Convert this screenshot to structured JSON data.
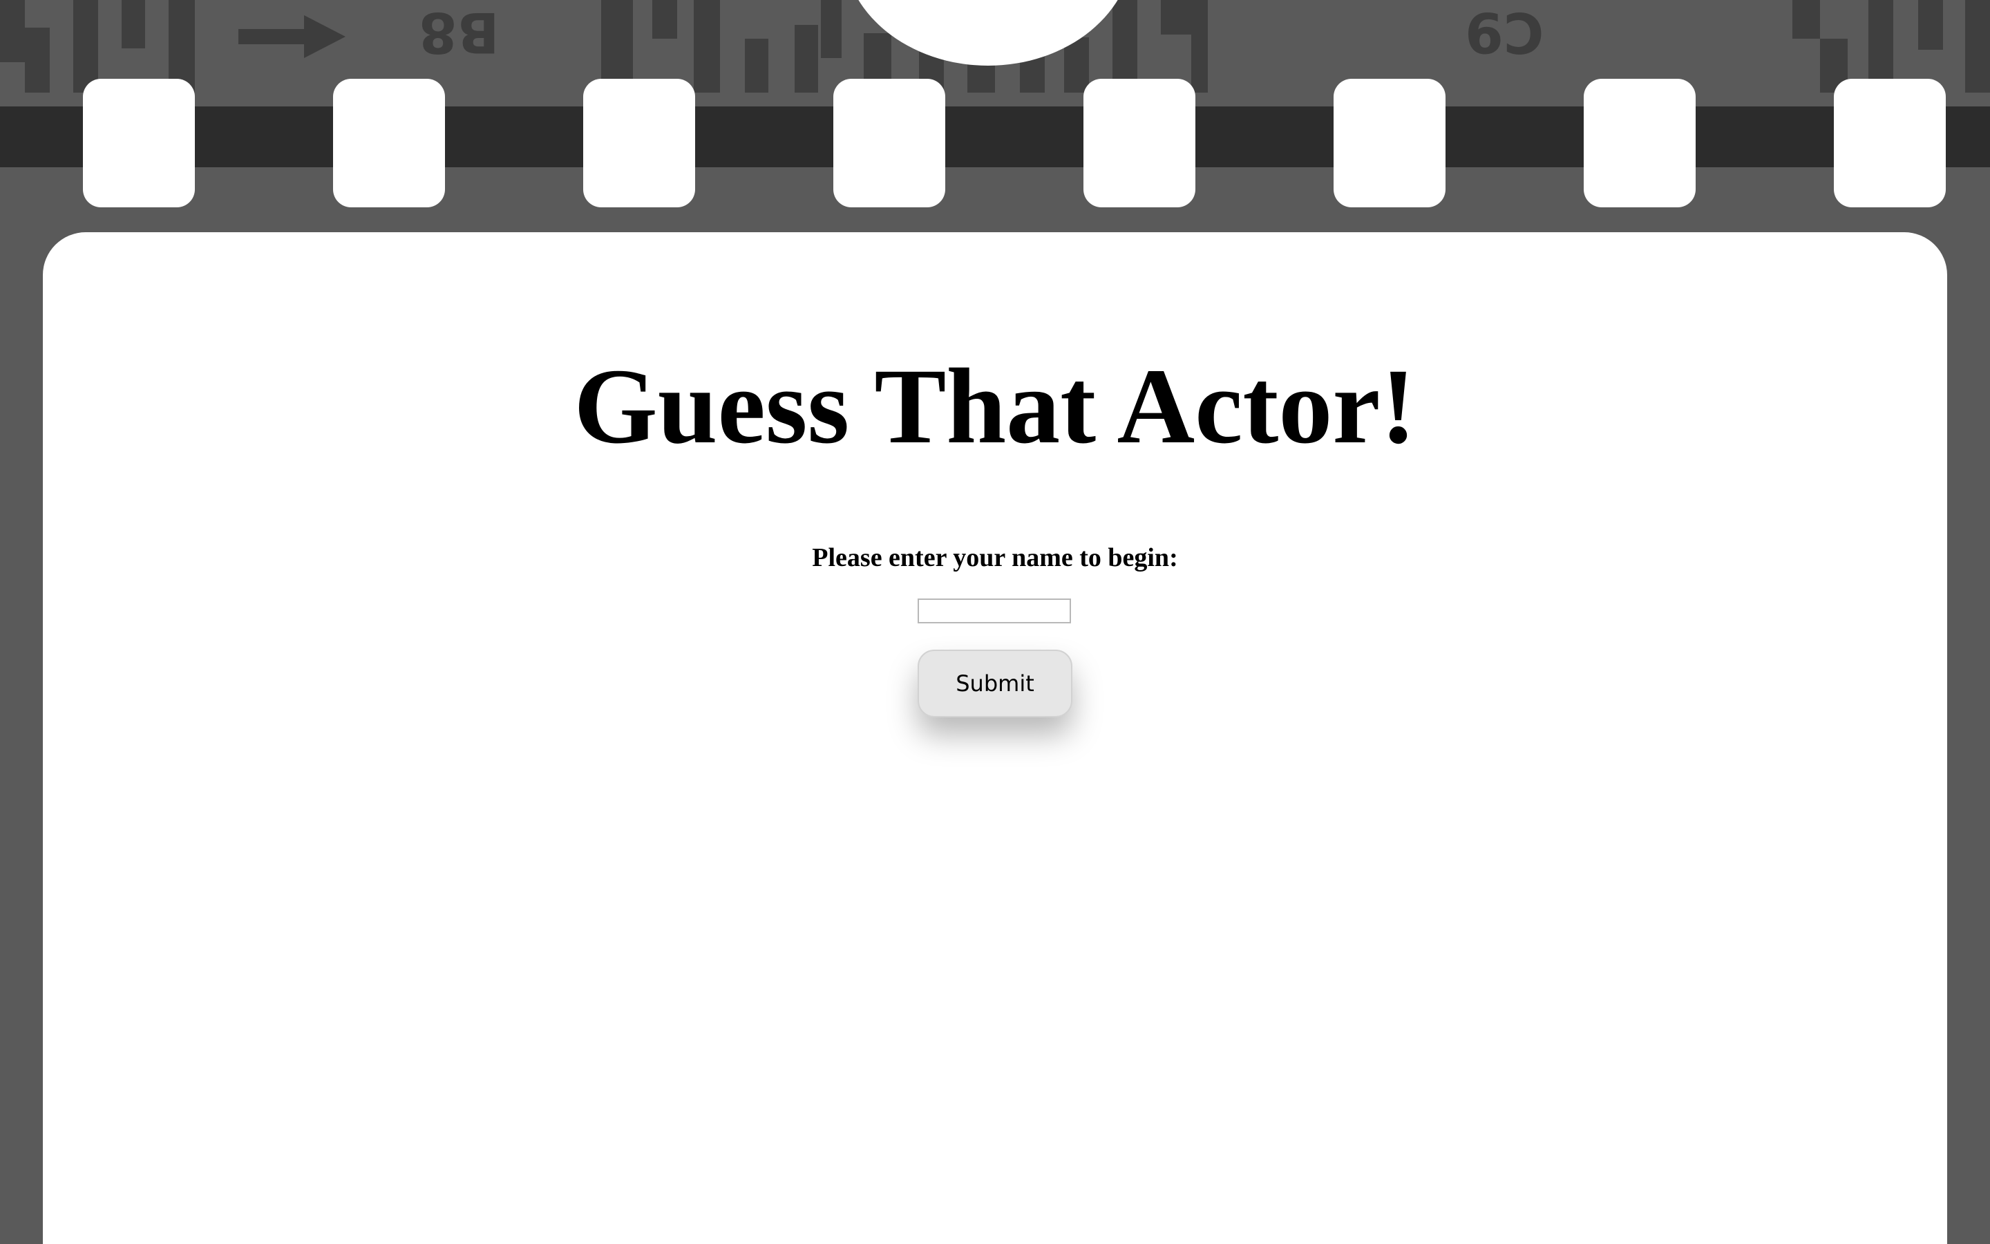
{
  "app": {
    "title": "Guess That Actor!"
  },
  "form": {
    "prompt": "Please enter your name to begin:",
    "name_value": "",
    "name_placeholder": "",
    "submit_label": "Submit"
  },
  "film_strip": {
    "edge_codes": [
      "B8",
      "C9"
    ]
  },
  "colors": {
    "background": "#5a5a5a",
    "film_stripe": "#2c2c2c",
    "panel": "#ffffff",
    "button": "#e6e6e6"
  }
}
